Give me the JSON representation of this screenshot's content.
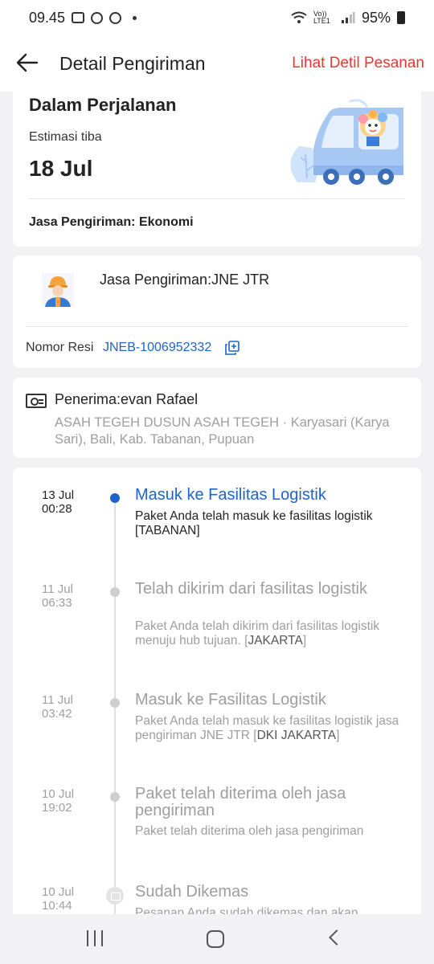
{
  "status_bar": {
    "time": "09.45",
    "network": "Vo)) LTE1",
    "battery": "95%"
  },
  "header": {
    "title": "Detail Pengiriman",
    "link": "Lihat Detil Pesanan"
  },
  "summary": {
    "status": "Dalam Perjalanan",
    "eta_label": "Estimasi tiba",
    "eta_date": "18 Jul",
    "service": "Jasa Pengiriman: Ekonomi"
  },
  "courier": {
    "title": "Jasa Pengiriman:JNE JTR",
    "resi_label": "Nomor Resi",
    "resi_value": "JNEB-1006952332"
  },
  "recipient": {
    "title": "Penerima:evan Rafael",
    "address": "ASAH TEGEH DUSUN ASAH TEGEH · Karyasari (Karya Sari), Bali, Kab. Tabanan, Pupuan"
  },
  "timeline": [
    {
      "date": "13 Jul",
      "time": "00:28",
      "title": "Masuk ke Fasilitas Logistik",
      "desc": "Paket Anda telah masuk ke fasilitas logistik [",
      "loc": "TABANAN",
      "desc_end": "]"
    },
    {
      "date": "11 Jul",
      "time": "06:33",
      "title": "Telah dikirim dari fasilitas logistik",
      "desc": "Paket Anda telah dikirim dari fasilitas logistik menuju hub tujuan. [",
      "loc": "JAKARTA",
      "desc_end": "]"
    },
    {
      "date": "11 Jul",
      "time": "03:42",
      "title": "Masuk ke Fasilitas Logistik",
      "desc": "Paket Anda telah masuk ke fasilitas logistik jasa pengiriman JNE JTR [",
      "loc": "DKI JAKARTA",
      "desc_end": "]"
    },
    {
      "date": "10 Jul",
      "time": "19:02",
      "title": "Paket telah diterima oleh jasa pengiriman",
      "desc": "Paket telah diterima oleh jasa pengiriman",
      "loc": "",
      "desc_end": ""
    },
    {
      "date": "10 Jul",
      "time": "10:44",
      "title": "Sudah Dikemas",
      "desc": "Pesanan Anda sudah dikemas dan akan",
      "loc": "",
      "desc_end": ""
    }
  ],
  "colors": {
    "accent_blue": "#1e63c8",
    "accent_red": "#e53935"
  }
}
